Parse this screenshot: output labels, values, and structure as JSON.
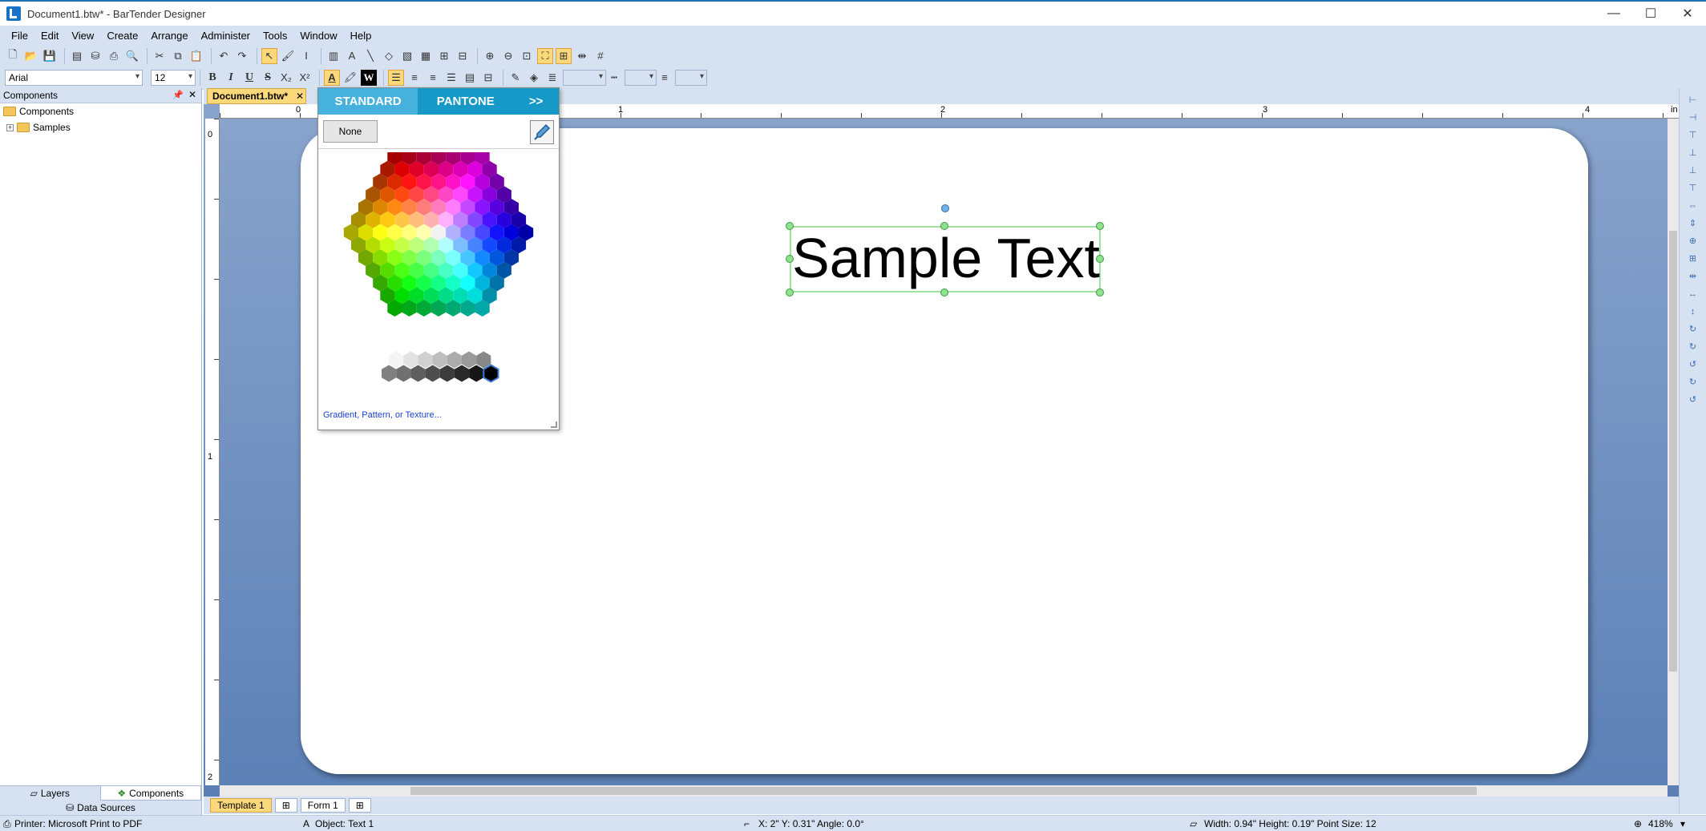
{
  "window": {
    "title": "Document1.btw* - BarTender Designer",
    "controls": [
      "—",
      "☐",
      "✕"
    ]
  },
  "menu": [
    "File",
    "Edit",
    "View",
    "Create",
    "Arrange",
    "Administer",
    "Tools",
    "Window",
    "Help"
  ],
  "font_toolbar": {
    "font_name": "Arial",
    "font_size": "12",
    "bold": "B",
    "italic": "I",
    "underline": "U",
    "strike": "S",
    "subscript": "X₂",
    "superscript": "X²",
    "w_label": "W"
  },
  "left_panel": {
    "header": "Components",
    "tree": [
      "Components",
      "Samples"
    ],
    "tabs": [
      "Layers",
      "Components"
    ],
    "data_sources": "Data Sources"
  },
  "document": {
    "tab_label": "Document1.btw*",
    "tab_close": "✕",
    "h_ruler_labels": [
      "0",
      "1",
      "2",
      "3",
      "4",
      "in"
    ],
    "v_ruler_labels": [
      "0",
      "1",
      "2"
    ],
    "sample_text": "Sample Text",
    "bottom_tabs": [
      "Template 1",
      "Form 1"
    ]
  },
  "color_picker": {
    "tabs": [
      "STANDARD",
      "PANTONE",
      ">>"
    ],
    "none_label": "None",
    "link_text": "Gradient, Pattern, or Texture..."
  },
  "status": {
    "printer": "Printer: Microsoft Print to PDF",
    "object": "Object: Text 1",
    "position": "X: 2\"  Y: 0.31\"  Angle: 0.0°",
    "dimensions": "Width: 0.94\"  Height: 0.19\"  Point Size: 12",
    "zoom": "418%"
  },
  "colors": {
    "accent": "#1699c7",
    "chrome": "#d6e2f1",
    "active_tab": "#fbd87a",
    "workspace": "#6f8fc1"
  }
}
